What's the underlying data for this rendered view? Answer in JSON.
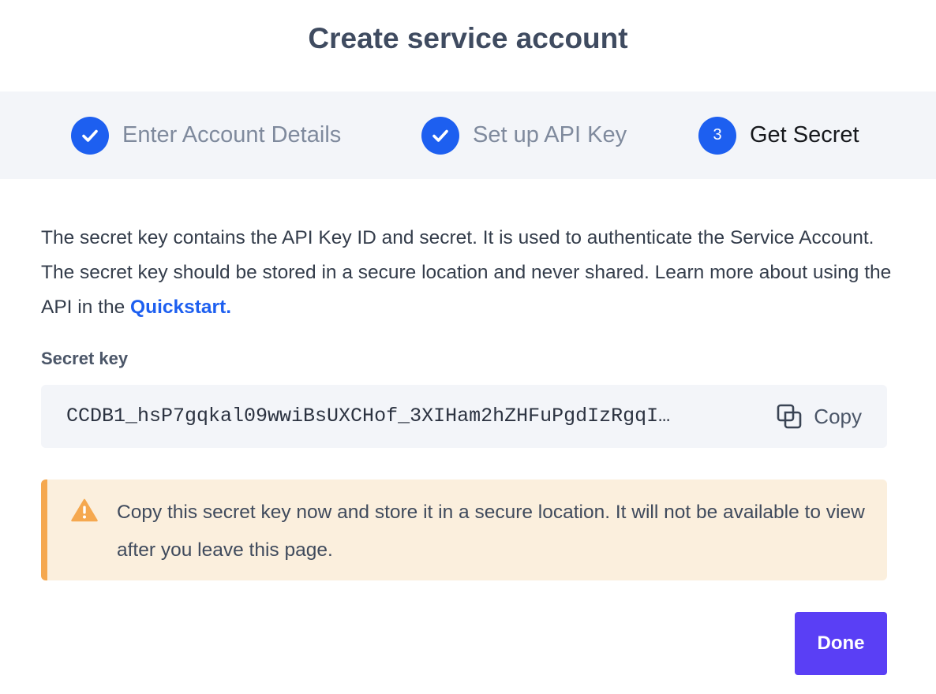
{
  "dialog": {
    "title": "Create service account"
  },
  "steps": [
    {
      "label": "Enter Account Details",
      "status": "complete",
      "icon": "check-icon"
    },
    {
      "label": "Set up API Key",
      "status": "complete",
      "icon": "check-icon"
    },
    {
      "number": "3",
      "label": "Get Secret",
      "status": "active"
    }
  ],
  "description": {
    "text": "The secret key contains the API Key ID and secret. It is used to authenticate the Service Account. The secret key should be stored in a secure location and never shared. Learn more about using the API in the ",
    "link": "Quickstart."
  },
  "secret": {
    "label": "Secret key",
    "value": "CCDB1_hsP7gqkal09wwiBsUXCHof_3XIHam2hZHFuPgdIzRgqI…",
    "copy_label": "Copy",
    "copy_icon": "copy-icon"
  },
  "warning": {
    "icon": "warning-icon",
    "text": "Copy this secret key now and store it in a secure location. It will not be available to view after you leave this page."
  },
  "actions": {
    "done_label": "Done"
  },
  "colors": {
    "primary": "#1d5ff0",
    "done_button": "#5a3ff5",
    "warning_bg": "#fbefdd",
    "warning_accent": "#f5a84f"
  }
}
